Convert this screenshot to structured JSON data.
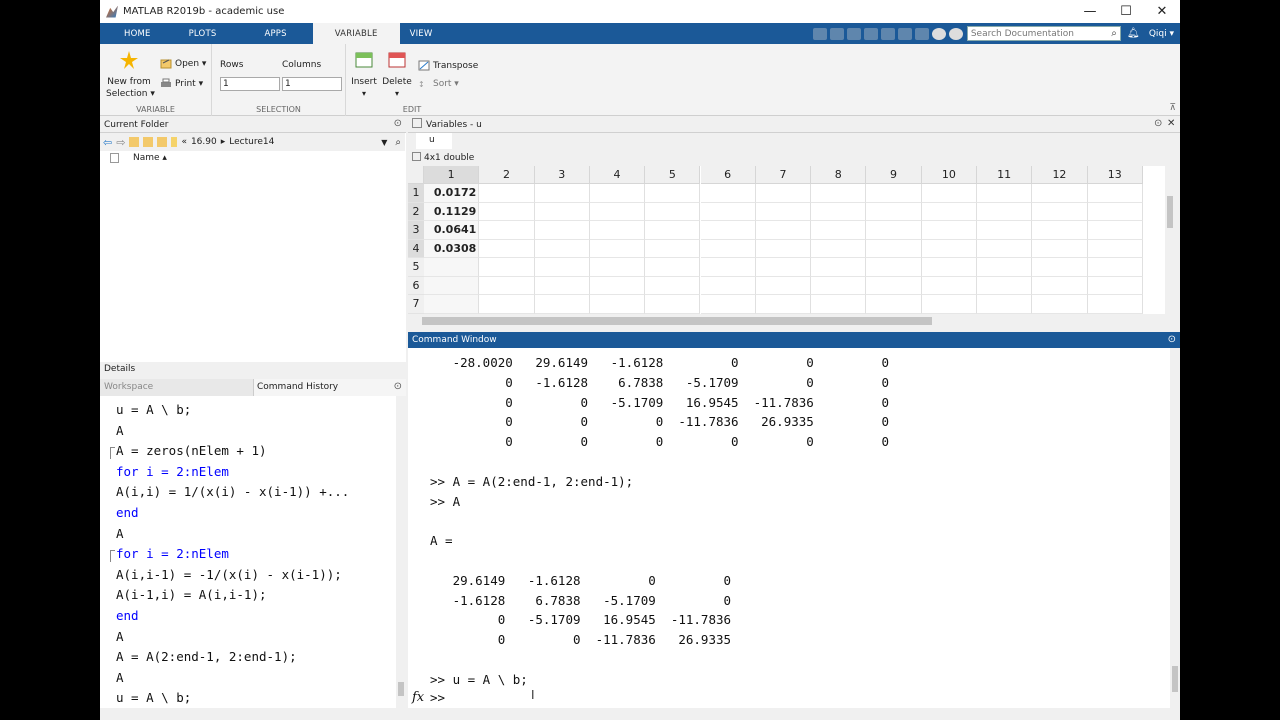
{
  "window": {
    "title": "MATLAB R2019b - academic use",
    "minimize": "—",
    "maximize": "☐",
    "close": "✕"
  },
  "ribbon_tabs": [
    "HOME",
    "PLOTS",
    "APPS",
    "VARIABLE",
    "VIEW"
  ],
  "active_tab": "VARIABLE",
  "search": {
    "placeholder": "Search Documentation"
  },
  "user": "Qiqi ▾",
  "ribbon": {
    "variable_group": {
      "new_from_selection": "New from\nSelection ▾",
      "open": "Open ▾",
      "print": "Print ▾",
      "label": "VARIABLE"
    },
    "selection_group": {
      "rows_label": "Rows",
      "columns_label": "Columns",
      "rows_value": "1",
      "columns_value": "1",
      "label": "SELECTION"
    },
    "edit_group": {
      "insert": "Insert",
      "delete": "Delete",
      "transpose": "Transpose",
      "sort": "Sort ▾",
      "label": "EDIT"
    }
  },
  "current_folder": {
    "header": "Current Folder",
    "path": [
      "«",
      "16.90",
      "▸",
      "Lecture14"
    ],
    "name_column": "Name ▴"
  },
  "details_header": "Details",
  "workspace_tab": "Workspace",
  "history_tab": "Command History",
  "history": [
    {
      "text": "u = A \\ b;",
      "kw": false,
      "marker": false
    },
    {
      "text": "A",
      "kw": false,
      "marker": false
    },
    {
      "text": "A = zeros(nElem + 1)",
      "kw": false,
      "marker": true
    },
    {
      "text": "for i = 2:nElem",
      "kw": true,
      "marker": false
    },
    {
      "text": "A(i,i) = 1/(x(i) - x(i-1)) +...",
      "kw": false,
      "marker": false
    },
    {
      "text": "end",
      "kw": true,
      "marker": false
    },
    {
      "text": "A",
      "kw": false,
      "marker": false
    },
    {
      "text": "for i = 2:nElem",
      "kw": true,
      "marker": true
    },
    {
      "text": "A(i,i-1) = -1/(x(i) - x(i-1));",
      "kw": false,
      "marker": false
    },
    {
      "text": "A(i-1,i) = A(i,i-1);",
      "kw": false,
      "marker": false
    },
    {
      "text": "end",
      "kw": true,
      "marker": false
    },
    {
      "text": "A",
      "kw": false,
      "marker": false
    },
    {
      "text": "A = A(2:end-1, 2:end-1);",
      "kw": false,
      "marker": false
    },
    {
      "text": "A",
      "kw": false,
      "marker": false
    },
    {
      "text": "u = A \\ b;",
      "kw": false,
      "marker": false
    }
  ],
  "variables": {
    "header": "Variables - u",
    "tab": "u",
    "type": "4x1 double",
    "columns": [
      "1",
      "2",
      "3",
      "4",
      "5",
      "6",
      "7",
      "8",
      "9",
      "10",
      "11",
      "12",
      "13"
    ],
    "rows": [
      "1",
      "2",
      "3",
      "4",
      "5",
      "6",
      "7"
    ],
    "values": [
      "0.0172",
      "0.1129",
      "0.0641",
      "0.0308"
    ]
  },
  "command_window": {
    "header": "Command Window",
    "lines": [
      "   -28.0020   29.6149   -1.6128         0         0         0",
      "          0   -1.6128    6.7838   -5.1709         0         0",
      "          0         0   -5.1709   16.9545  -11.7836         0",
      "          0         0         0  -11.7836   26.9335         0",
      "          0         0         0         0         0         0",
      "",
      ">> A = A(2:end-1, 2:end-1);",
      ">> A",
      "",
      "A =",
      "",
      "   29.6149   -1.6128         0         0",
      "   -1.6128    6.7838   -5.1709         0",
      "         0   -5.1709   16.9545  -11.7836",
      "         0         0  -11.7836   26.9335",
      "",
      ">> u = A \\ b;"
    ],
    "prompt": ">>",
    "fx": "fx"
  }
}
